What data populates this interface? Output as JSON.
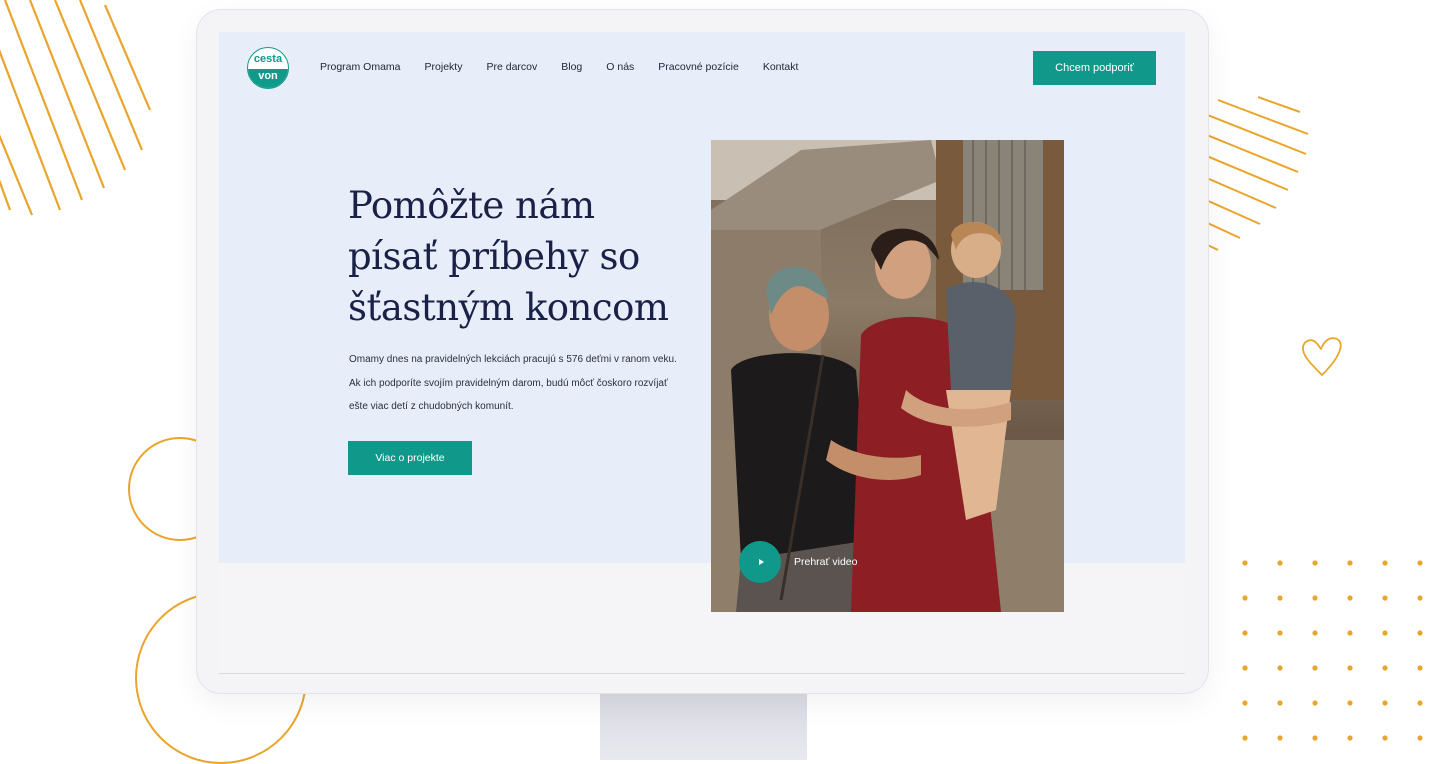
{
  "logo": {
    "line1": "cesta",
    "line2": "von"
  },
  "nav": {
    "items": [
      {
        "label": "Program Omama"
      },
      {
        "label": "Projekty"
      },
      {
        "label": "Pre darcov"
      },
      {
        "label": "Blog"
      },
      {
        "label": "O nás"
      },
      {
        "label": "Pracovné pozície"
      },
      {
        "label": "Kontakt"
      }
    ],
    "cta_label": "Chcem podporiť"
  },
  "hero": {
    "headline": "Pomôžte nám písať príbehy so šťastným koncom",
    "description": "Omamy dnes na pravidelných lekciách pracujú s 576 deťmi v ranom veku. Ak ich podporíte svojím pravidelným darom, budú môcť čoskoro rozvíjať ešte viac detí z chudobných komunít.",
    "button_label": "Viac o projekte",
    "video_label": "Prehrať video"
  },
  "colors": {
    "brand": "#10998a",
    "heading": "#1a2147",
    "hero_bg": "#e8eef9",
    "accent_deco": "#e9a52c"
  },
  "icons": {
    "play": "play-icon",
    "heart": "heart-icon"
  }
}
